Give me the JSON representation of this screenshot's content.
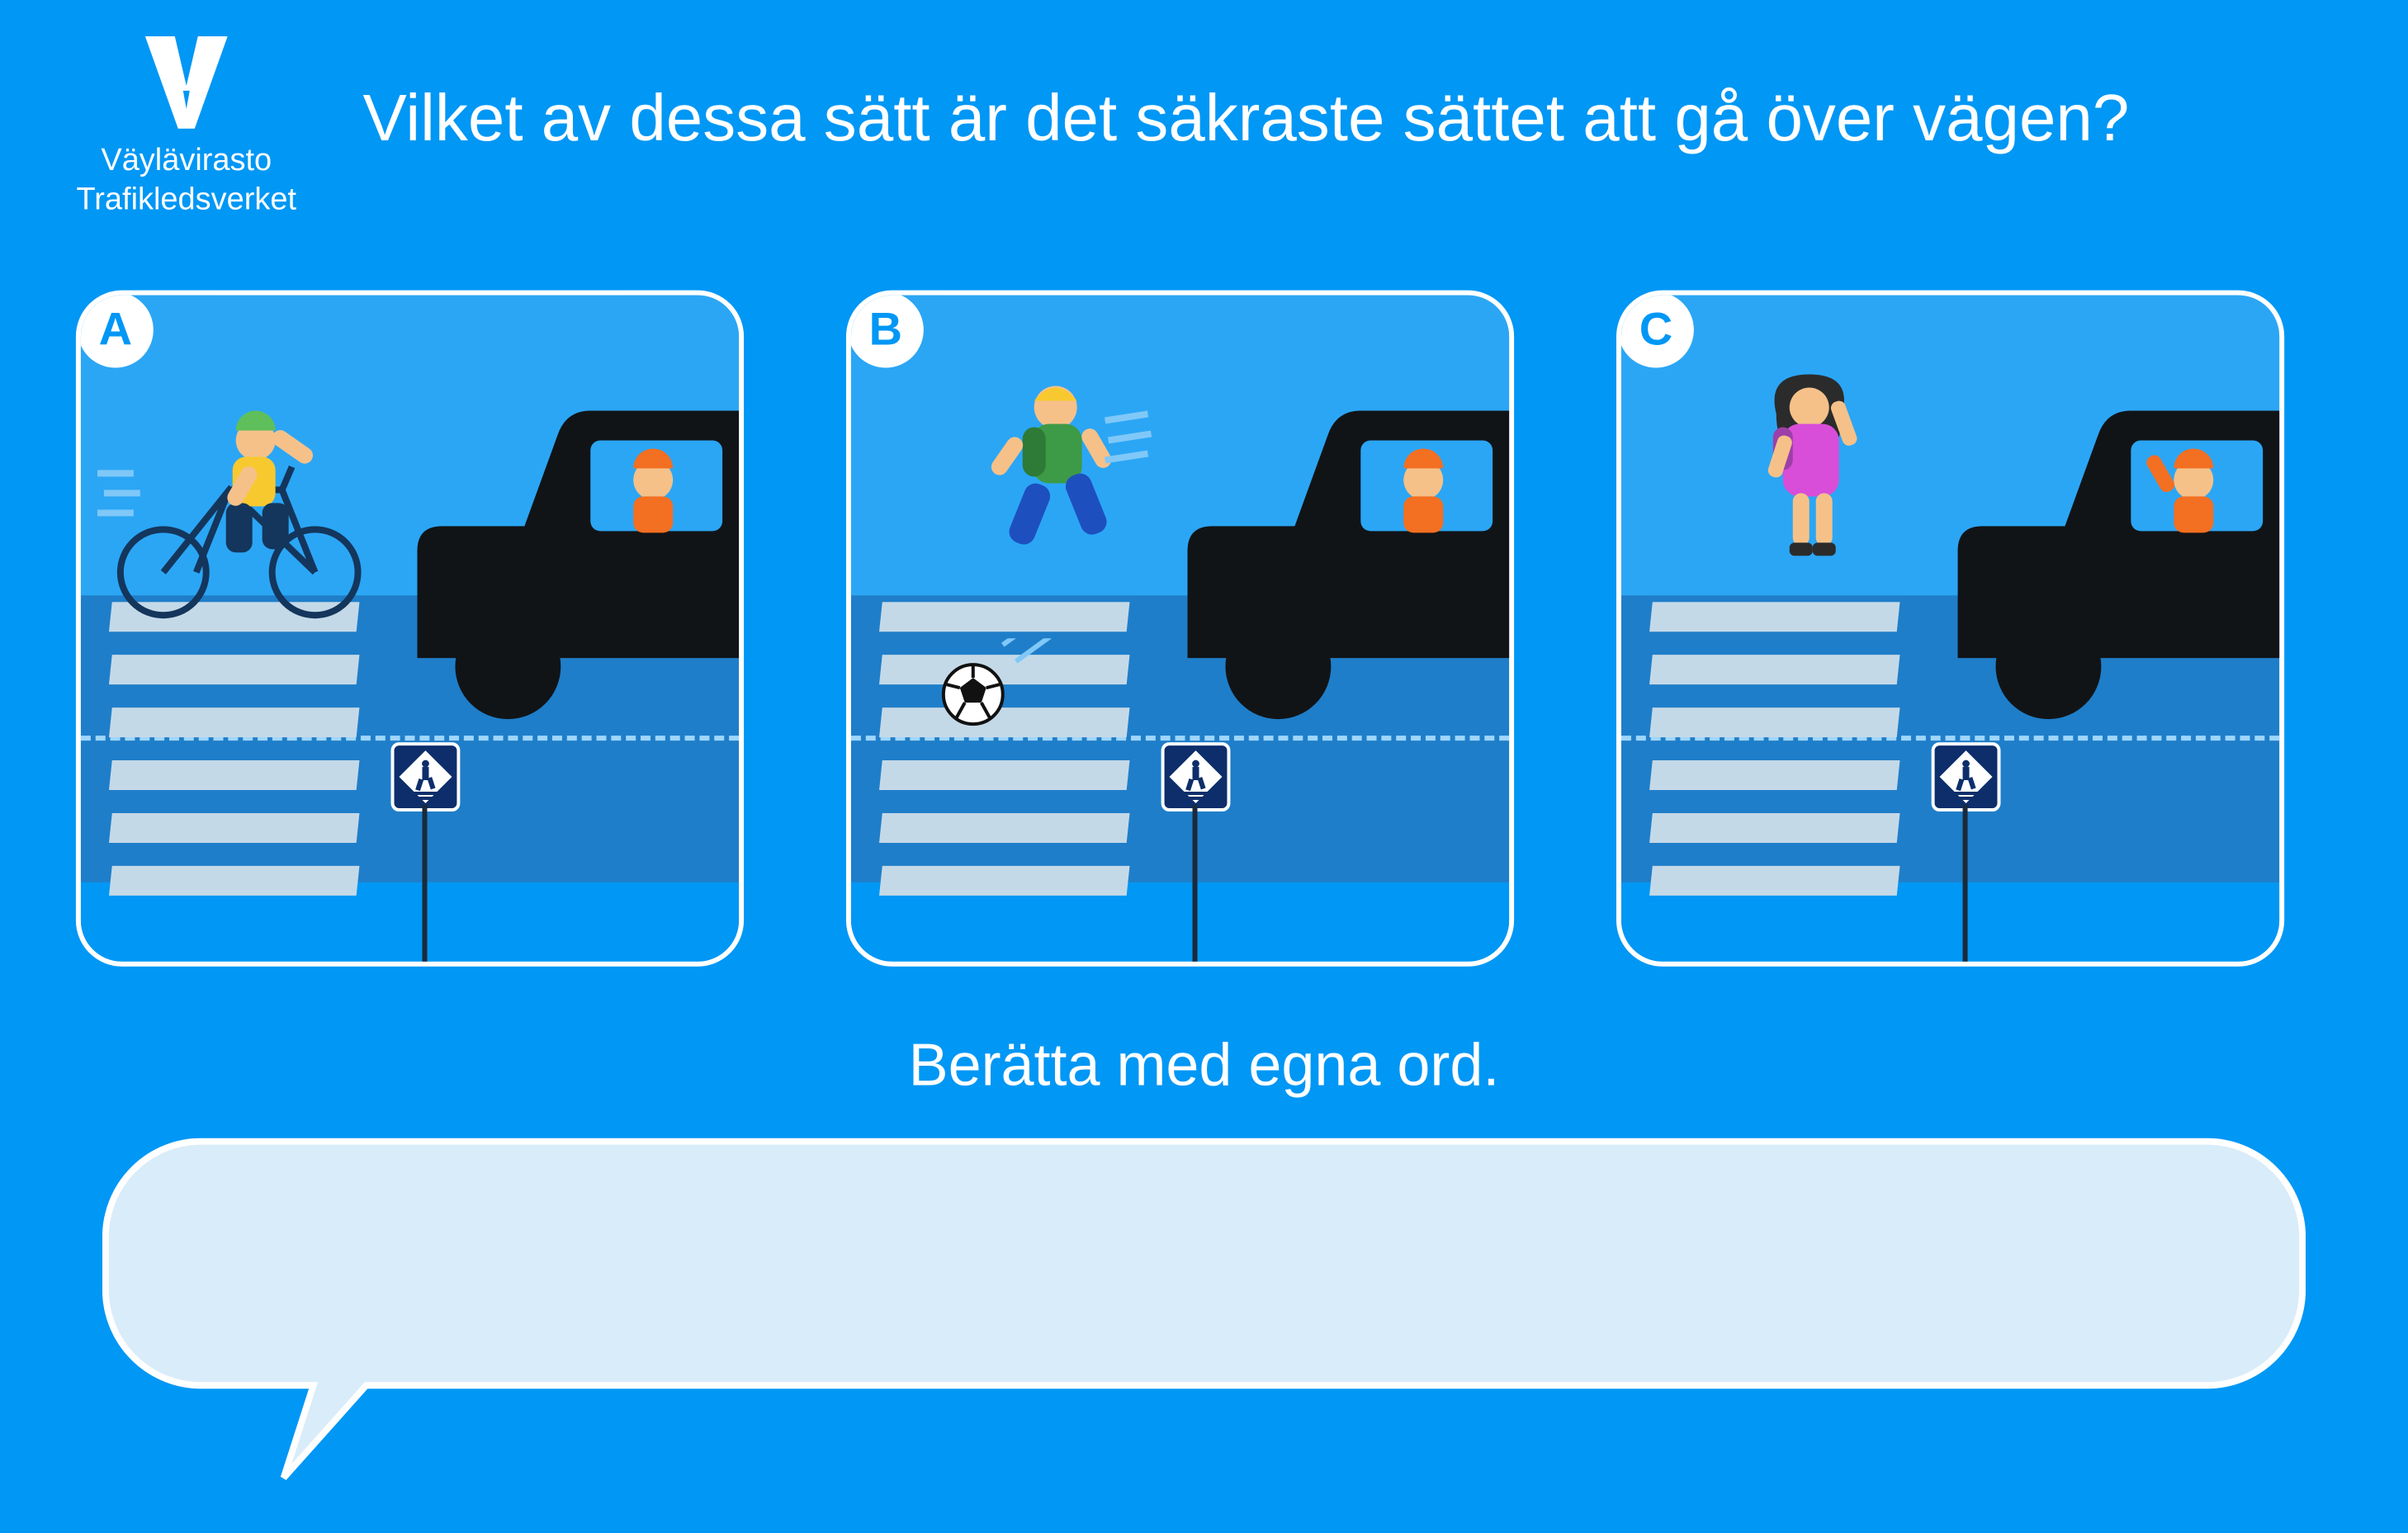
{
  "agency": {
    "name_fi": "Väylävirasto",
    "name_sv": "Trafikledsverket"
  },
  "question": "Vilket av dessa sätt är det säkraste sättet att gå över vägen?",
  "options": [
    {
      "id": "A",
      "label": "A",
      "scene": "cyclist"
    },
    {
      "id": "B",
      "label": "B",
      "scene": "running-child-ball"
    },
    {
      "id": "C",
      "label": "C",
      "scene": "waiting-girl"
    }
  ],
  "prompt": "Berätta med egna ord.",
  "answer": {
    "placeholder": ""
  },
  "icons": {
    "crosswalk_sign": "pedestrian-crossing-sign"
  },
  "colors": {
    "bg": "#0097f5",
    "sky": "#2ba6f5",
    "road": "#1f7ec9",
    "truck": "#111417",
    "driver": "#f36f21"
  }
}
